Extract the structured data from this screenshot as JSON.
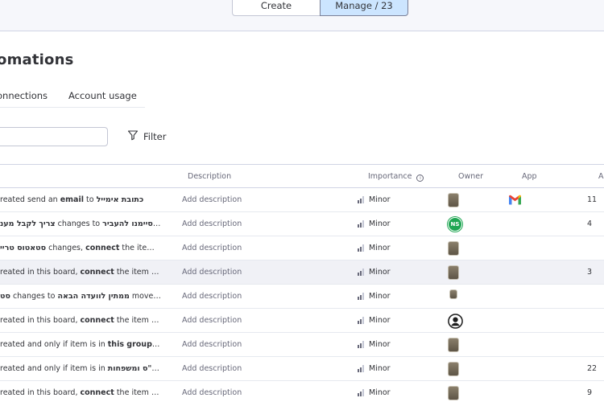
{
  "header": {
    "create_label": "Create",
    "manage_label": "Manage / 23"
  },
  "page": {
    "title": "omations",
    "tabs": [
      "onnections",
      "Account usage"
    ],
    "filter_label": "Filter"
  },
  "table": {
    "columns": {
      "description": "Description",
      "importance": "Importance",
      "owner": "Owner",
      "app": "App",
      "last": "A"
    },
    "rows": [
      {
        "parts": [
          [
            "reated send an ",
            false
          ],
          [
            "email",
            true
          ],
          [
            " to ",
            false
          ],
          [
            "כתובת אימייל",
            true
          ]
        ],
        "description": "Add description",
        "importance": "Minor",
        "owner_icon": "photo-avatar",
        "app_icon": "gmail-icon",
        "count": "11"
      },
      {
        "parts": [
          [
            "צריך לקבל מענ",
            true
          ],
          [
            " changes to ",
            false
          ],
          [
            "סיימנו להעביר...",
            true
          ]
        ],
        "description": "Add description",
        "importance": "Minor",
        "owner_icon": "initials-avatar",
        "owner_initials": "NS",
        "count": "4"
      },
      {
        "parts": [
          [
            "סטאטוס טריי",
            true
          ],
          [
            " changes, ",
            false
          ],
          [
            "connect",
            true
          ],
          [
            " the item ...",
            false
          ]
        ],
        "description": "Add description",
        "importance": "Minor",
        "owner_icon": "photo-avatar",
        "count": ""
      },
      {
        "parts": [
          [
            "reated in this board, ",
            false
          ],
          [
            "connect",
            true
          ],
          [
            " the item w...",
            false
          ]
        ],
        "description": "Add description",
        "importance": "Minor",
        "owner_icon": "photo-avatar",
        "count": "3",
        "highlight": true
      },
      {
        "parts": [
          [
            "סט",
            true
          ],
          [
            " changes to ",
            false
          ],
          [
            "ממתין לוועדה הבאה",
            true
          ],
          [
            " move ...",
            false
          ]
        ],
        "description": "Add description",
        "importance": "Minor",
        "owner_icon": "photo-avatar-small",
        "count": ""
      },
      {
        "parts": [
          [
            "reated in this board, ",
            false
          ],
          [
            "connect",
            true
          ],
          [
            " the item w...",
            false
          ]
        ],
        "description": "Add description",
        "importance": "Minor",
        "owner_icon": "user-icon",
        "count": ""
      },
      {
        "parts": [
          [
            "reated and only if item is in ",
            false
          ],
          [
            "this group n...",
            true
          ]
        ],
        "description": "Add description",
        "importance": "Minor",
        "owner_icon": "photo-avatar",
        "count": ""
      },
      {
        "parts": [
          [
            "reated and only if item is in ",
            false
          ],
          [
            "ו\"ס ומשפחות...",
            true
          ]
        ],
        "description": "Add description",
        "importance": "Minor",
        "owner_icon": "photo-avatar",
        "count": "22"
      },
      {
        "parts": [
          [
            "reated in this board, ",
            false
          ],
          [
            "connect",
            true
          ],
          [
            " the item w...",
            false
          ]
        ],
        "description": "Add description",
        "importance": "Minor",
        "owner_icon": "photo-avatar",
        "count": "9"
      }
    ]
  },
  "colors": {
    "accent": "#cce5ff",
    "border": "#d0d4e4",
    "ns_green": "#1fa653"
  }
}
